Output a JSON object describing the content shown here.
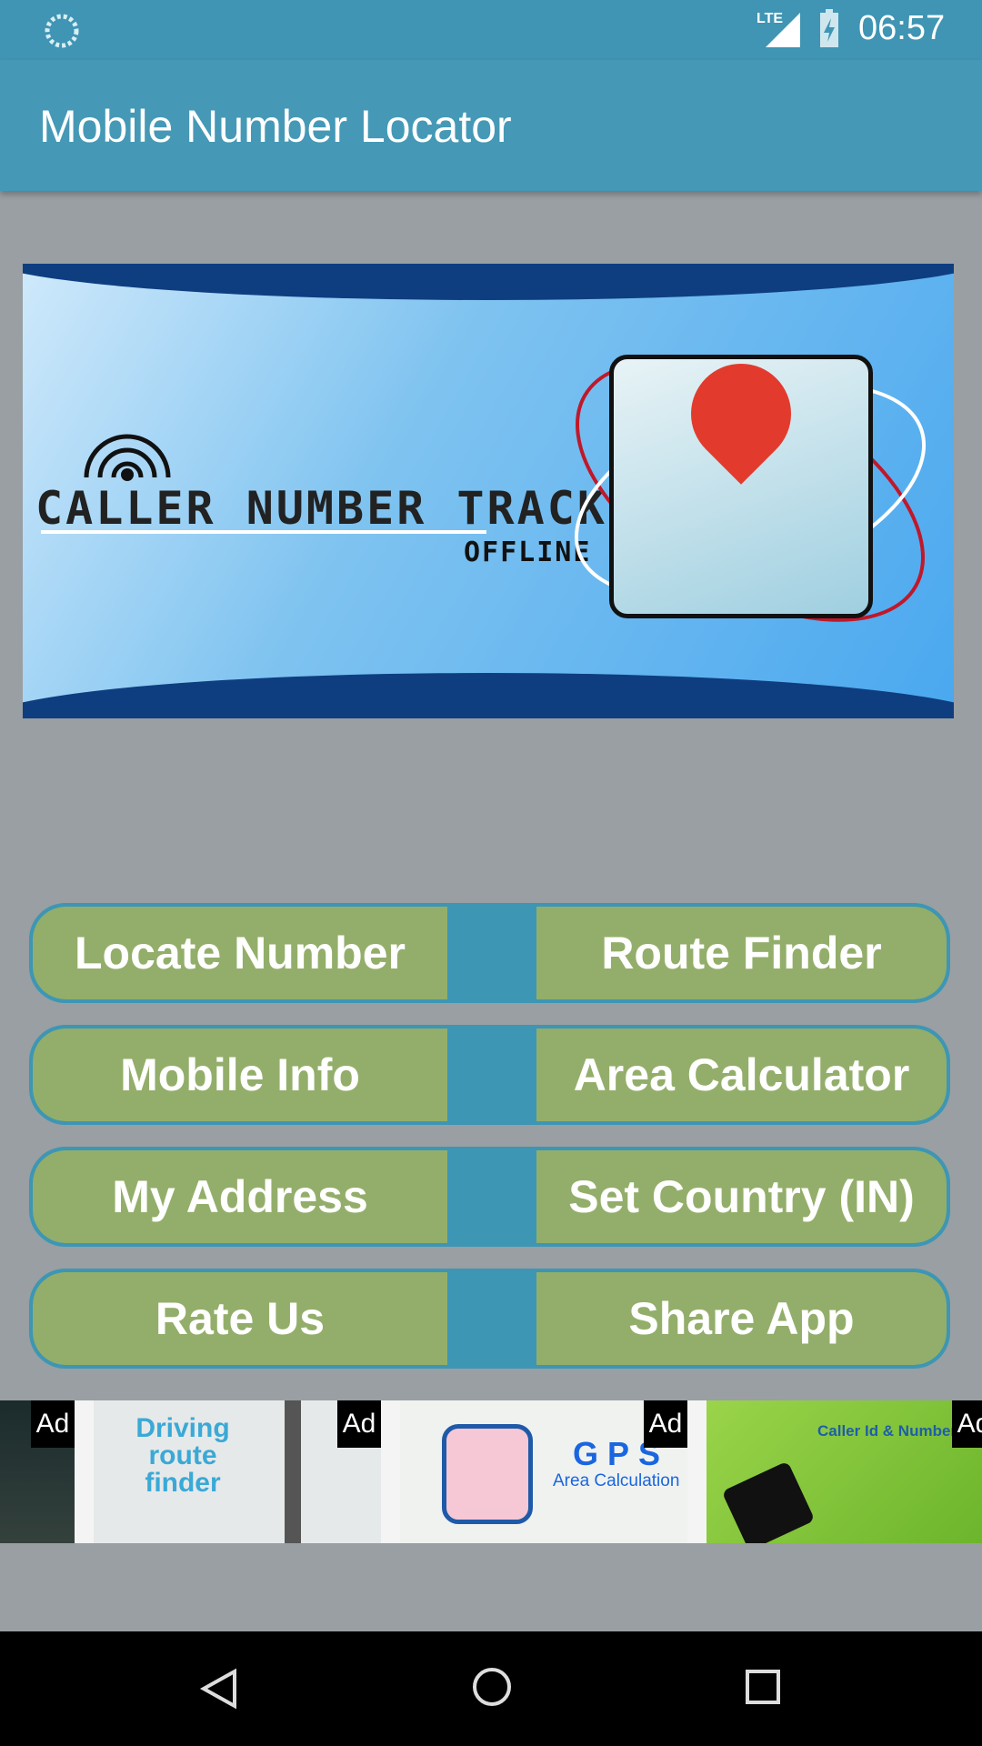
{
  "status_bar": {
    "time": "06:57",
    "network": "LTE",
    "icons": [
      "sync-icon",
      "signal-icon",
      "battery-charging-icon"
    ]
  },
  "app_bar": {
    "title": "Mobile Number Locator"
  },
  "banner": {
    "title": "CALLER NUMBER TRACKER",
    "subtitle": "OFFLINE"
  },
  "buttons": [
    {
      "left": "Locate Number",
      "right": "Route Finder"
    },
    {
      "left": "Mobile Info",
      "right": "Area Calculator"
    },
    {
      "left": "My Address",
      "right": "Set Country (IN)"
    },
    {
      "left": "Rate Us",
      "right": "Share App"
    }
  ],
  "ads": [
    {
      "tag": "Ad",
      "text": ""
    },
    {
      "tag": "Ad",
      "text": "Driving route finder"
    },
    {
      "tag": "Ad",
      "text": "GPS",
      "sub": "Area Calculation"
    },
    {
      "tag": "Ad",
      "text": "Caller Id & Number T"
    }
  ],
  "colors": {
    "primary": "#4599b6",
    "button": "#93ae6a",
    "background": "#999fa3"
  }
}
